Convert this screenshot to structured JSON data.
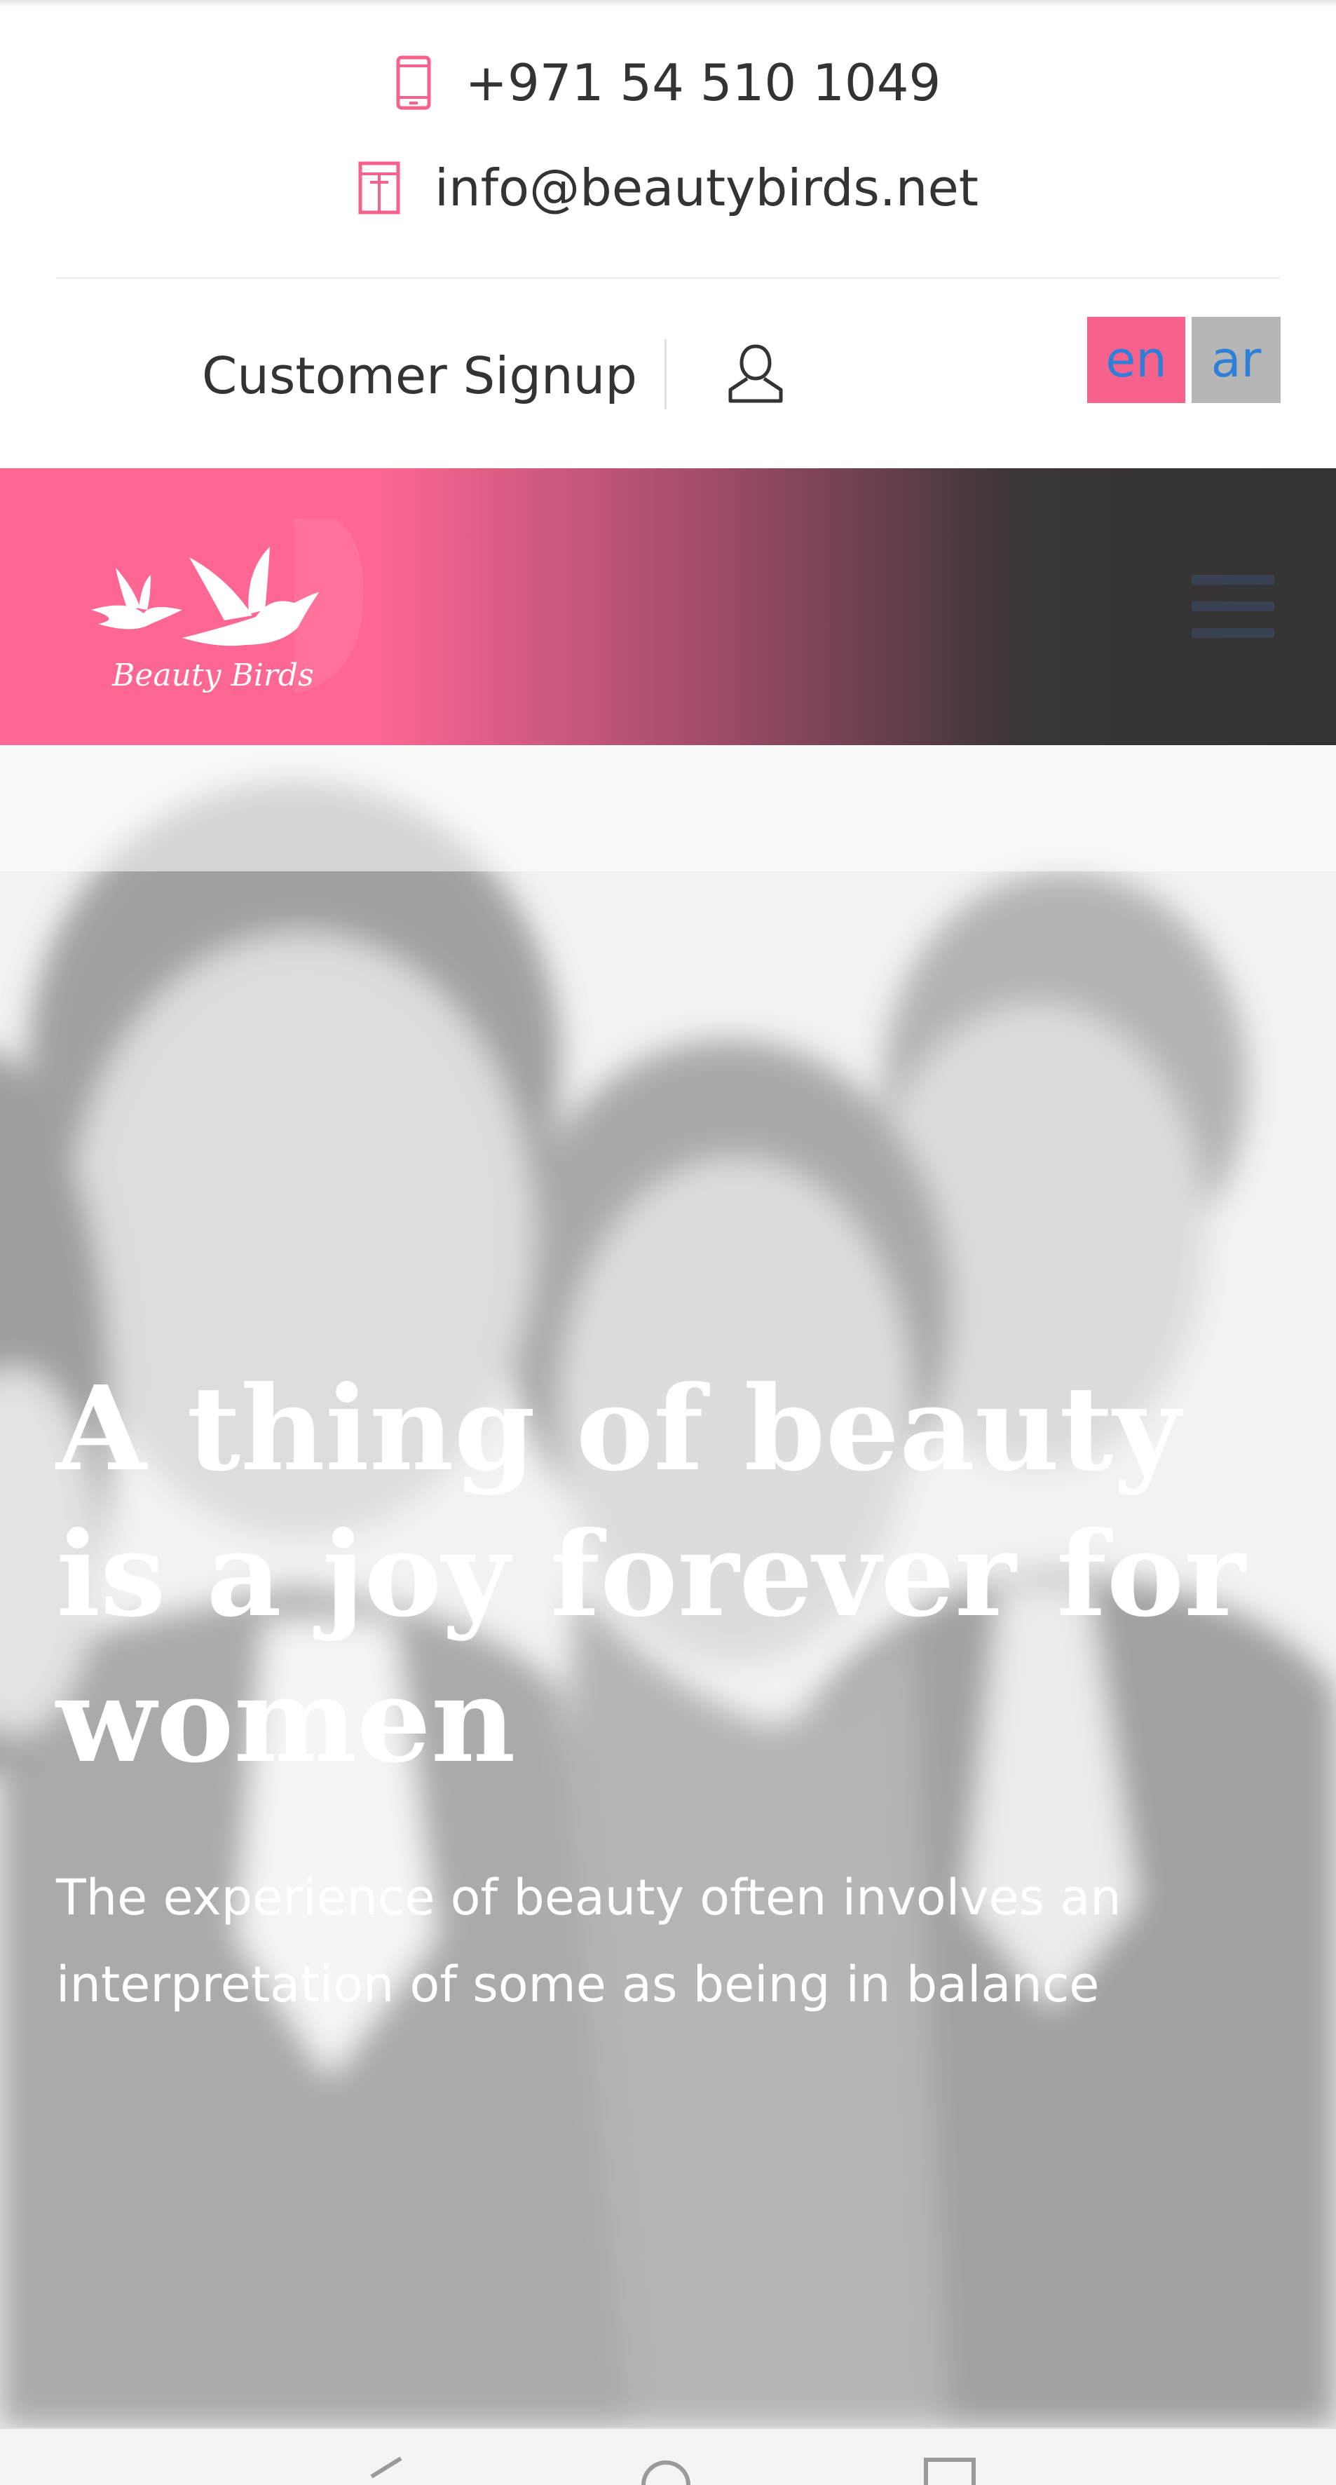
{
  "contact": {
    "phone": "+971 54 510 1049",
    "phone_icon": "mobile-phone-icon",
    "email": "info@beautybirds.net",
    "email_icon": "building-icon"
  },
  "account": {
    "signup_label": "Customer Signup",
    "user_icon": "user-icon"
  },
  "languages": [
    {
      "code": "en",
      "active": true
    },
    {
      "code": "ar",
      "active": false
    }
  ],
  "header": {
    "logo_text": "Beauty Birds",
    "menu_icon": "hamburger-menu-icon"
  },
  "hero": {
    "title": "A thing of beauty is a joy forever for women",
    "subtitle": "The experience of beauty often involves an interpretation of some as being in balance"
  },
  "system_nav": {
    "buttons": [
      "back-icon",
      "home-icon",
      "recents-icon"
    ]
  },
  "colors": {
    "brand_pink": "#fe6794",
    "dark": "#333333",
    "link_blue": "#2d7fd8",
    "lang_inactive": "#b6b6b6"
  }
}
